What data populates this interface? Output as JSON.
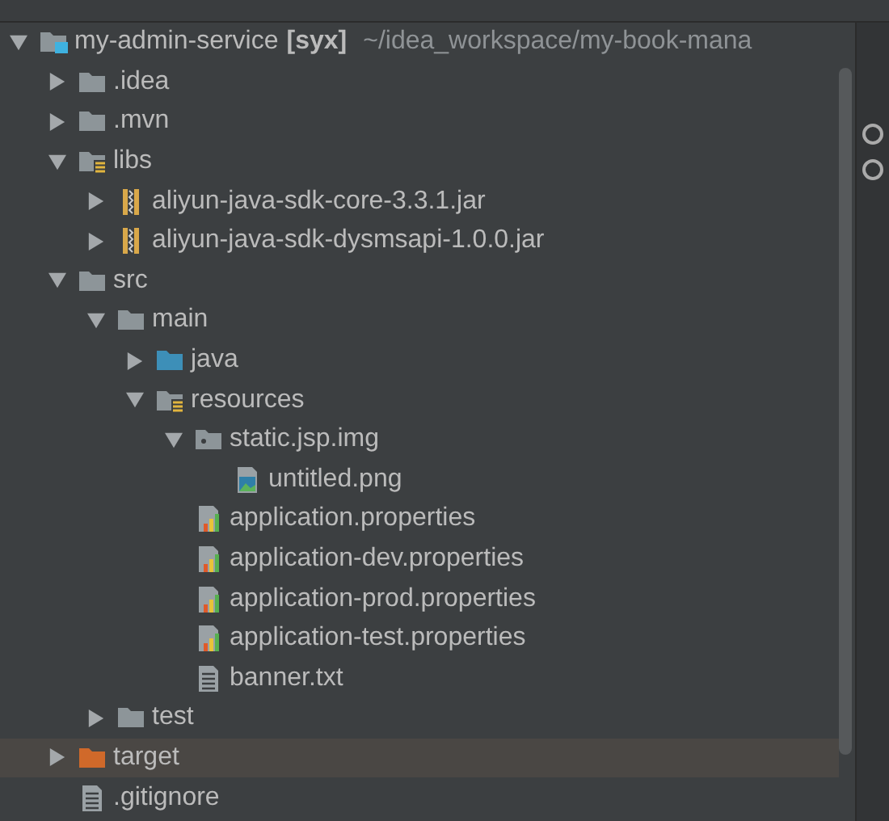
{
  "tree": [
    {
      "kind": "module",
      "name": "my-admin-service",
      "tag": "[syx]",
      "path": "~/idea_workspace/my-book-mana",
      "expanded": true,
      "selected": false,
      "children": [
        {
          "kind": "folder",
          "name": ".idea",
          "expanded": false,
          "selected": false
        },
        {
          "kind": "folder",
          "name": ".mvn",
          "expanded": false,
          "selected": false
        },
        {
          "kind": "libs-folder",
          "name": "libs",
          "expanded": true,
          "selected": false,
          "children": [
            {
              "kind": "jar",
              "name": "aliyun-java-sdk-core-3.3.1.jar",
              "expanded": false,
              "selected": false
            },
            {
              "kind": "jar",
              "name": "aliyun-java-sdk-dysmsapi-1.0.0.jar",
              "expanded": false,
              "selected": false
            }
          ]
        },
        {
          "kind": "folder",
          "name": "src",
          "expanded": true,
          "selected": false,
          "children": [
            {
              "kind": "folder",
              "name": "main",
              "expanded": true,
              "selected": false,
              "children": [
                {
                  "kind": "source-folder",
                  "name": "java",
                  "expanded": false,
                  "selected": false
                },
                {
                  "kind": "resources-folder",
                  "name": "resources",
                  "expanded": true,
                  "selected": false,
                  "children": [
                    {
                      "kind": "package",
                      "name": "static.jsp.img",
                      "expanded": true,
                      "selected": false,
                      "children": [
                        {
                          "kind": "image-file",
                          "name": "untitled.png",
                          "selected": false
                        }
                      ]
                    },
                    {
                      "kind": "properties-file",
                      "name": "application.properties",
                      "selected": false
                    },
                    {
                      "kind": "properties-file",
                      "name": "application-dev.properties",
                      "selected": false
                    },
                    {
                      "kind": "properties-file",
                      "name": "application-prod.properties",
                      "selected": false
                    },
                    {
                      "kind": "properties-file",
                      "name": "application-test.properties",
                      "selected": false
                    },
                    {
                      "kind": "text-file",
                      "name": "banner.txt",
                      "selected": false
                    }
                  ]
                }
              ]
            },
            {
              "kind": "folder",
              "name": "test",
              "expanded": false,
              "selected": false
            }
          ]
        },
        {
          "kind": "excluded-folder",
          "name": "target",
          "expanded": false,
          "selected": true
        },
        {
          "kind": "text-file",
          "name": ".gitignore",
          "selected": false
        }
      ]
    }
  ]
}
